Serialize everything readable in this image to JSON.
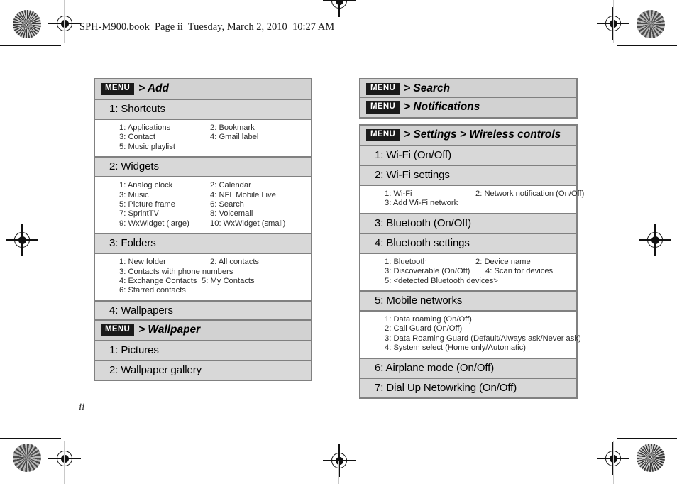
{
  "page": {
    "header_line": "SPH-M900.book  Page ii  Tuesday, March 2, 2010  10:27 AM",
    "folio": "ii",
    "menu_badge": "MENU"
  },
  "tables": {
    "add": {
      "menu_path": "> Add",
      "sections": [
        {
          "title": "1: Shortcuts",
          "lines": [
            [
              "1: Applications",
              "2: Bookmark"
            ],
            [
              "3: Contact",
              "4: Gmail label"
            ],
            [
              "5: Music playlist",
              ""
            ]
          ]
        },
        {
          "title": "2: Widgets",
          "lines": [
            [
              "1: Analog clock",
              "2: Calendar"
            ],
            [
              "3: Music",
              "4: NFL Mobile Live"
            ],
            [
              "5: Picture frame",
              "6: Search"
            ],
            [
              "7: SprintTV",
              "8: Voicemail"
            ],
            [
              "9: WxWidget (large)",
              "10: WxWidget (small)"
            ]
          ]
        },
        {
          "title": "3: Folders",
          "lines": [
            [
              "1: New folder",
              "2: All contacts"
            ],
            [
              "3: Contacts with phone numbers",
              ""
            ],
            [
              "4: Exchange Contacts",
              "5: My Contacts"
            ],
            [
              "6: Starred contacts",
              ""
            ]
          ]
        },
        {
          "title": "4: Wallpapers",
          "lines": [
            [
              "1: Pictures",
              "2: Wallpaper gallery"
            ]
          ]
        }
      ]
    },
    "wallpaper": {
      "menu_path": "> Wallpaper",
      "sections": [
        {
          "title": "1: Pictures"
        },
        {
          "title": "2: Wallpaper gallery"
        }
      ]
    },
    "search": {
      "menu_path": "> Search"
    },
    "notifications": {
      "menu_path": "> Notifications"
    },
    "wireless": {
      "menu_path": "> Settings > Wireless controls",
      "sections": [
        {
          "title": "1: Wi-Fi (On/Off)"
        },
        {
          "title": "2: Wi-Fi settings",
          "lines": [
            [
              "1: Wi-Fi",
              "2: Network notification (On/Off)"
            ],
            [
              "3: Add Wi-Fi network",
              ""
            ]
          ]
        },
        {
          "title": "3: Bluetooth (On/Off)"
        },
        {
          "title": "4: Bluetooth settings",
          "lines": [
            [
              "1: Bluetooth",
              "2: Device name"
            ],
            [
              "3: Discoverable (On/Off)",
              "4: Scan for devices"
            ],
            [
              "5: <detected Bluetooth devices>",
              ""
            ]
          ]
        },
        {
          "title": "5: Mobile networks",
          "lines": [
            [
              "1: Data roaming (On/Off)",
              ""
            ],
            [
              "2: Call Guard (On/Off)",
              ""
            ],
            [
              "3: Data Roaming Guard (Default/Always ask/Never ask)",
              ""
            ],
            [
              "4: System select (Home only/Automatic)",
              ""
            ]
          ]
        },
        {
          "title": "6: Airplane mode (On/Off)"
        },
        {
          "title": "7: Dial Up Netowrking (On/Off)"
        }
      ]
    }
  }
}
